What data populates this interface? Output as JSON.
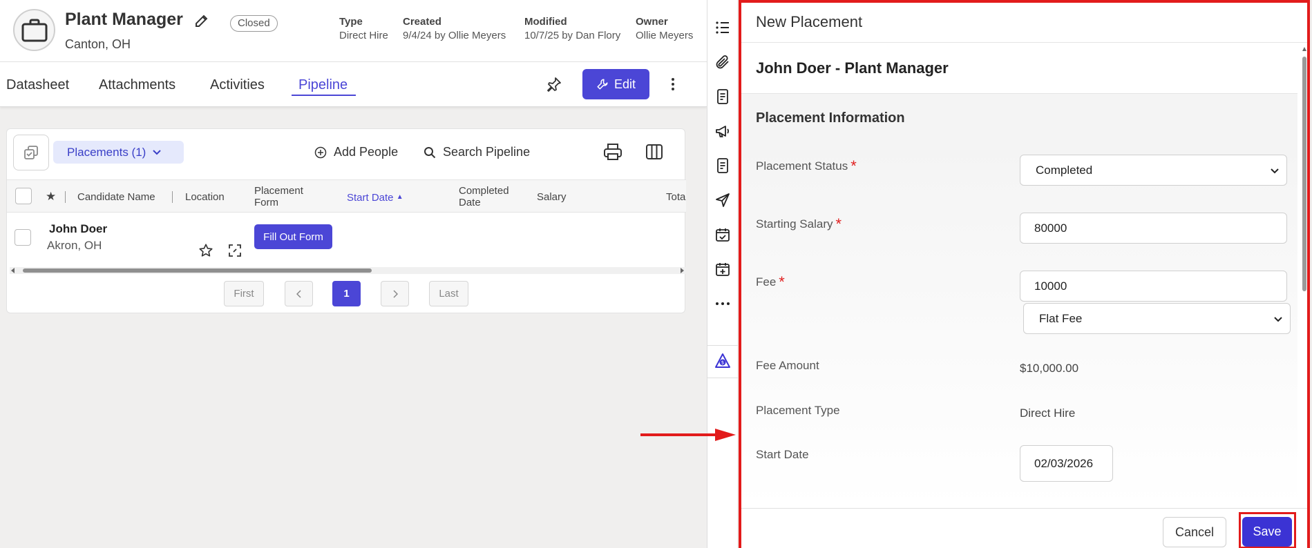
{
  "job": {
    "title": "Plant Manager",
    "status": "Closed",
    "location": "Canton, OH",
    "meta": [
      {
        "key": "Type",
        "value": "Direct Hire"
      },
      {
        "key": "Created",
        "value": "9/4/24 by Ollie Meyers"
      },
      {
        "key": "Modified",
        "value": "10/7/25 by Dan Flory"
      },
      {
        "key": "Owner",
        "value": "Ollie Meyers"
      }
    ]
  },
  "tabs": [
    {
      "label": "Datasheet"
    },
    {
      "label": "Attachments"
    },
    {
      "label": "Activities"
    },
    {
      "label": "Pipeline",
      "active": true
    }
  ],
  "actions": {
    "edit_label": "Edit"
  },
  "pipeline": {
    "dropdown_label": "Placements (1)",
    "add_people_label": "Add People",
    "search_label": "Search Pipeline",
    "columns": {
      "candidate": "Candidate Name",
      "location": "Location",
      "placement_form_1": "Placement",
      "placement_form_2": "Form",
      "start_date": "Start Date",
      "completed_1": "Completed",
      "completed_2": "Date",
      "salary": "Salary",
      "total": "Tota"
    },
    "rows": [
      {
        "name": "John Doer",
        "location": "Akron, OH",
        "form_button": "Fill Out Form"
      }
    ],
    "pagination": {
      "first": "First",
      "current": "1",
      "last": "Last"
    }
  },
  "panel": {
    "title": "New Placement",
    "record_title": "John Doer - Plant Manager",
    "section_title": "Placement Information",
    "fields": {
      "status": {
        "label": "Placement Status",
        "value": "Completed"
      },
      "salary": {
        "label": "Starting Salary",
        "value": "80000"
      },
      "fee": {
        "label": "Fee",
        "value": "10000",
        "fee_type": "Flat Fee"
      },
      "fee_amount": {
        "label": "Fee Amount",
        "value": "$10,000.00"
      },
      "placement_type": {
        "label": "Placement Type",
        "value": "Direct Hire"
      },
      "start_date": {
        "label": "Start Date",
        "value": "02/03/2026"
      }
    },
    "required_mark": "*",
    "cancel_label": "Cancel",
    "save_label": "Save"
  },
  "colors": {
    "accent": "#4b46d6",
    "highlight": "#e21b1b"
  }
}
